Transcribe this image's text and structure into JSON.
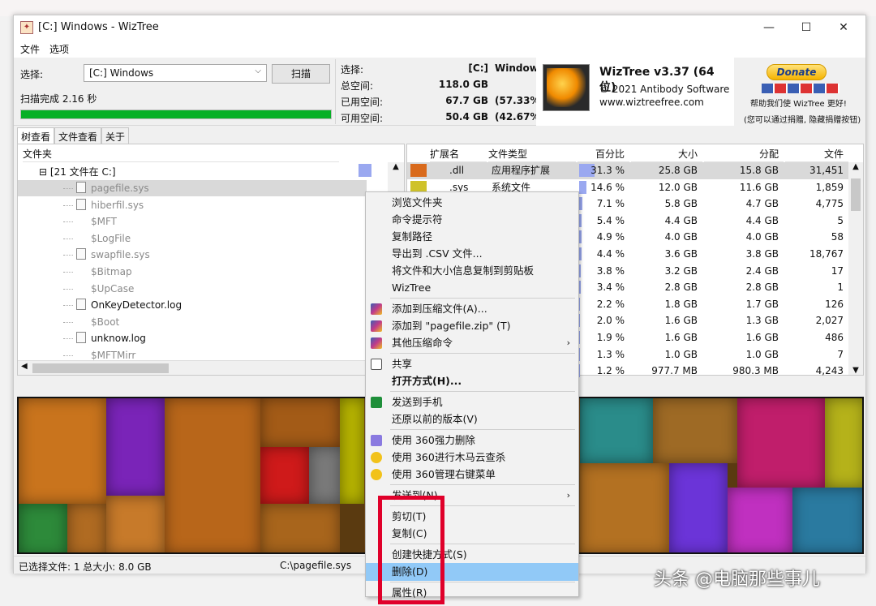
{
  "window": {
    "title": "[C:] Windows  - WizTree",
    "minimize": "—",
    "maximize": "☐",
    "close": "✕"
  },
  "menu": [
    "文件",
    "选项"
  ],
  "scan": {
    "select_label": "选择:",
    "select_value": "[C:] Windows",
    "scan_button": "扫描",
    "status": "扫描完成 2.16 秒",
    "progress": 1.0
  },
  "stats": [
    {
      "label": "选择:",
      "value": "[C:]",
      "extra": "Window"
    },
    {
      "label": "总空间:",
      "value": "118.0 GB",
      "extra": ""
    },
    {
      "label": "已用空间:",
      "value": "67.7 GB",
      "extra": "(57.33%"
    },
    {
      "label": "可用空间:",
      "value": "50.4 GB",
      "extra": "(42.67%"
    }
  ],
  "about": {
    "product": "WizTree v3.37 (64 位)",
    "copyright": "© 2021 Antibody Software",
    "url": "www.wiztreefree.com"
  },
  "donate": {
    "button": "Donate",
    "text": "帮助我们使 WizTree 更好!",
    "note": "(您可以通过捐赠, 隐藏捐赠按钮)"
  },
  "tabs": [
    "树查看",
    "文件查看",
    "关于"
  ],
  "tree": {
    "header": "文件夹",
    "root": "[21 文件在 C:]",
    "rows": [
      {
        "name": "pagefile.sys",
        "dim": true,
        "icon": true
      },
      {
        "name": "hiberfil.sys",
        "dim": true,
        "icon": true
      },
      {
        "name": "$MFT",
        "dim": true,
        "icon": false
      },
      {
        "name": "$LogFile",
        "dim": true,
        "icon": false
      },
      {
        "name": "swapfile.sys",
        "dim": true,
        "icon": true
      },
      {
        "name": "$Bitmap",
        "dim": true,
        "icon": false
      },
      {
        "name": "$UpCase",
        "dim": true,
        "icon": false
      },
      {
        "name": "OnKeyDetector.log",
        "dim": false,
        "icon": true
      },
      {
        "name": "$Boot",
        "dim": true,
        "icon": false
      },
      {
        "name": "unknow.log",
        "dim": false,
        "icon": true
      },
      {
        "name": "$MFTMirr",
        "dim": true,
        "icon": false
      }
    ]
  },
  "ext_table": {
    "headers": [
      "扩展名",
      "文件类型",
      "百分比",
      "大小",
      "分配",
      "文件"
    ],
    "rows": [
      {
        "ext": ".dll",
        "type": "应用程序扩展",
        "pct": "31.3 %",
        "pct_value": 31.3,
        "size": "25.8 GB",
        "alloc": "15.8 GB",
        "files": "31,451",
        "color": "#d96a1c"
      },
      {
        "ext": ".sys",
        "type": "系统文件",
        "pct": "14.6 %",
        "pct_value": 14.6,
        "size": "12.0 GB",
        "alloc": "11.6 GB",
        "files": "1,859",
        "color": "#cfc22a"
      },
      {
        "ext": "",
        "type": "",
        "pct": "7.1 %",
        "pct_value": 7.1,
        "size": "5.8 GB",
        "alloc": "4.7 GB",
        "files": "4,775",
        "color": "#ffffff"
      },
      {
        "ext": "",
        "type": "",
        "pct": "5.4 %",
        "pct_value": 5.4,
        "size": "4.4 GB",
        "alloc": "4.4 GB",
        "files": "5",
        "color": "#ffffff"
      },
      {
        "ext": "",
        "type": "",
        "pct": "4.9 %",
        "pct_value": 4.9,
        "size": "4.0 GB",
        "alloc": "4.0 GB",
        "files": "58",
        "color": "#ffffff"
      },
      {
        "ext": "",
        "type": "",
        "pct": "4.4 %",
        "pct_value": 4.4,
        "size": "3.6 GB",
        "alloc": "3.8 GB",
        "files": "18,767",
        "color": "#ffffff"
      },
      {
        "ext": "",
        "type": "",
        "pct": "3.8 %",
        "pct_value": 3.8,
        "size": "3.2 GB",
        "alloc": "2.4 GB",
        "files": "17",
        "color": "#ffffff"
      },
      {
        "ext": "",
        "type": "",
        "pct": "3.4 %",
        "pct_value": 3.4,
        "size": "2.8 GB",
        "alloc": "2.8 GB",
        "files": "1",
        "color": "#ffffff"
      },
      {
        "ext": "",
        "type": "",
        "pct": "2.2 %",
        "pct_value": 2.2,
        "size": "1.8 GB",
        "alloc": "1.7 GB",
        "files": "126",
        "color": "#ffffff"
      },
      {
        "ext": "",
        "type": "",
        "pct": "2.0 %",
        "pct_value": 2.0,
        "size": "1.6 GB",
        "alloc": "1.3 GB",
        "files": "2,027",
        "color": "#ffffff"
      },
      {
        "ext": "",
        "type": "",
        "pct": "1.9 %",
        "pct_value": 1.9,
        "size": "1.6 GB",
        "alloc": "1.6 GB",
        "files": "486",
        "color": "#ffffff"
      },
      {
        "ext": "",
        "type": "",
        "pct": "1.3 %",
        "pct_value": 1.3,
        "size": "1.0 GB",
        "alloc": "1.0 GB",
        "files": "7",
        "color": "#ffffff"
      },
      {
        "ext": "",
        "type": "",
        "pct": "1.2 %",
        "pct_value": 1.2,
        "size": "977.7 MB",
        "alloc": "980.3 MB",
        "files": "4,243",
        "color": "#ffffff"
      }
    ]
  },
  "status_bar": {
    "selected": "已选择文件: 1  总大小: 8.0 GB",
    "path": "C:\\pagefile.sys"
  },
  "context_menu": {
    "items": [
      {
        "label": "浏览文件夹",
        "bold": false,
        "icon": "",
        "sub": false
      },
      {
        "label": "命令提示符",
        "bold": false,
        "icon": "",
        "sub": false
      },
      {
        "label": "复制路径",
        "bold": false,
        "icon": "",
        "sub": false
      },
      {
        "label": "导出到 .CSV 文件...",
        "bold": false,
        "icon": "",
        "sub": false
      },
      {
        "label": "将文件和大小信息复制到剪贴板",
        "bold": false,
        "icon": "",
        "sub": false
      },
      {
        "label": "WizTree",
        "bold": false,
        "icon": "",
        "sub": false,
        "sep_after": true
      },
      {
        "label": "添加到压缩文件(A)...",
        "bold": false,
        "icon": "winrar-icon",
        "sub": false
      },
      {
        "label": "添加到 \"pagefile.zip\" (T)",
        "bold": false,
        "icon": "winrar-icon",
        "sub": false
      },
      {
        "label": "其他压缩命令",
        "bold": false,
        "icon": "winrar-icon",
        "sub": true,
        "sep_after": true
      },
      {
        "label": "共享",
        "bold": false,
        "icon": "share-icon",
        "sub": false
      },
      {
        "label": "打开方式(H)...",
        "bold": true,
        "icon": "",
        "sub": false,
        "sep_after": true
      },
      {
        "label": "发送到手机",
        "bold": false,
        "icon": "phone-send-icon",
        "sub": false
      },
      {
        "label": "还原以前的版本(V)",
        "bold": false,
        "icon": "",
        "sub": false,
        "sep_after": true
      },
      {
        "label": "使用 360强力删除",
        "bold": false,
        "icon": "shred-icon",
        "sub": false
      },
      {
        "label": "使用 360进行木马云查杀",
        "bold": false,
        "icon": "360-icon",
        "sub": false
      },
      {
        "label": "使用 360管理右键菜单",
        "bold": false,
        "icon": "360-icon",
        "sub": false,
        "sep_after": true
      },
      {
        "label": "发送到(N)",
        "bold": false,
        "icon": "",
        "sub": true,
        "sep_after": true
      },
      {
        "label": "剪切(T)",
        "bold": false,
        "icon": "",
        "sub": false
      },
      {
        "label": "复制(C)",
        "bold": false,
        "icon": "",
        "sub": false,
        "sep_after": true
      },
      {
        "label": "创建快捷方式(S)",
        "bold": false,
        "icon": "",
        "sub": false
      },
      {
        "label": "删除(D)",
        "bold": false,
        "icon": "",
        "sub": false,
        "highlight": true,
        "sep_after": true
      },
      {
        "label": "属性(R)",
        "bold": false,
        "icon": "",
        "sub": false
      }
    ]
  },
  "watermark": "头条 @电脑那些事儿",
  "colors": {
    "progress": "#06b025",
    "highlight": "#91c9f7",
    "annotation": "#e0002a"
  }
}
